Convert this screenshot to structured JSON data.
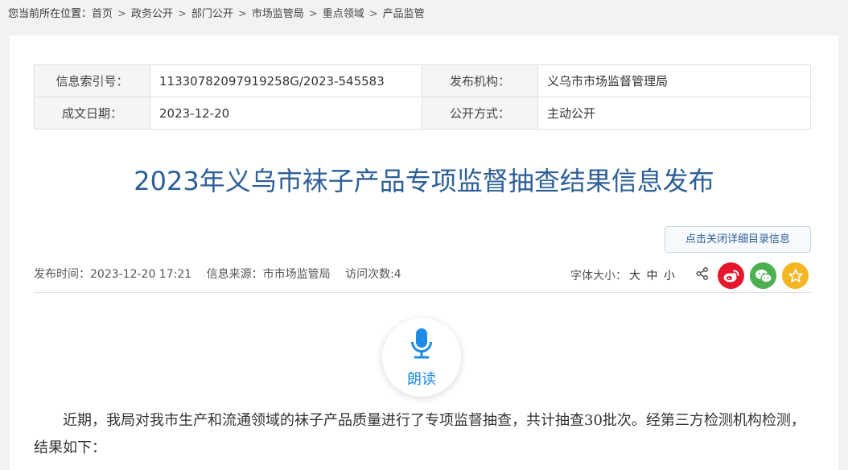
{
  "breadcrumb": {
    "lead": "您当前所在位置：",
    "items": [
      "首页",
      "政务公开",
      "部门公开",
      "市场监管局",
      "重点领域",
      "产品监管"
    ],
    "separator": ">"
  },
  "meta": {
    "index_label": "信息索引号：",
    "index_value": "11330782097919258G/2023-545583",
    "publisher_label": "发布机构：",
    "publisher_value": "义乌市市场监督管理局",
    "date_label": "成文日期：",
    "date_value": "2023-12-20",
    "disclosure_label": "公开方式：",
    "disclosure_value": "主动公开"
  },
  "title": "2023年义乌市袜子产品专项监督抽查结果信息发布",
  "toggle_catalog_label": "点击关闭详细目录信息",
  "info": {
    "publish_time": "发布时间：2023-12-20 17:21",
    "source": "信息来源：市市场监管局",
    "visits": "访问次数:4"
  },
  "font_size": {
    "label": "字体大小：",
    "large": "大",
    "medium": "中",
    "small": "小"
  },
  "icons": {
    "share": "share-icon",
    "weibo": "weibo-icon",
    "wechat": "wechat-icon",
    "favorite": "star-icon",
    "mic": "microphone-icon"
  },
  "colors": {
    "title": "#2d5f99",
    "weibo": "#e6162d",
    "wechat": "#4caf50",
    "favorite": "#f2b625",
    "read_accent": "#1e8be6"
  },
  "read_aloud_label": "朗读",
  "content": {
    "paragraph1": "近期，我局对我市生产和流通领域的袜子产品质量进行了专项监督抽查，共计抽查30批次。经第三方检测机构检测，结果如下："
  }
}
